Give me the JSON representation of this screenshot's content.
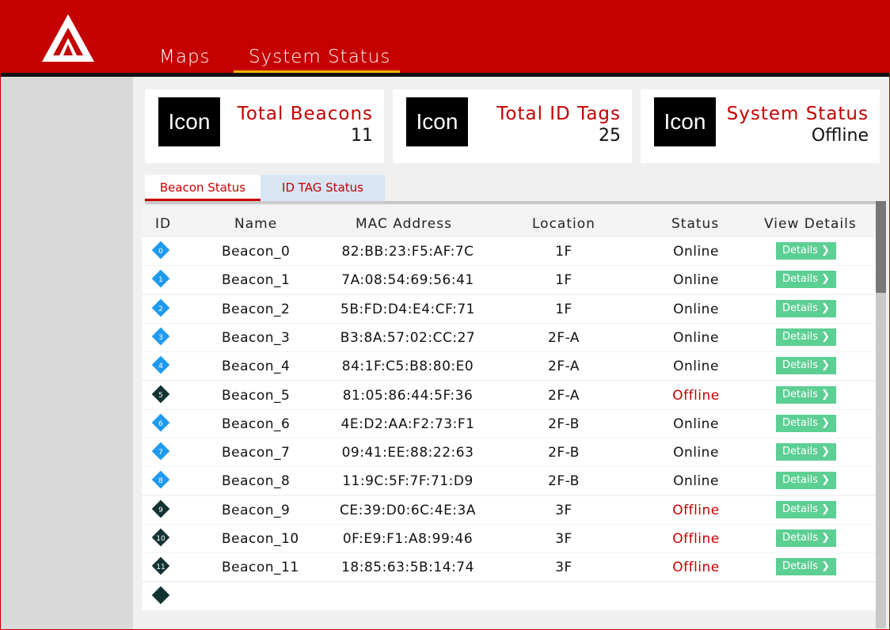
{
  "nav": {
    "maps": "Maps",
    "system_status": "System Status",
    "active": "system_status"
  },
  "summary": {
    "beacons": {
      "icon": "Icon",
      "label": "Total Beacons",
      "value": "11"
    },
    "id_tags": {
      "icon": "Icon",
      "label": "Total ID Tags",
      "value": "25"
    },
    "system": {
      "icon": "Icon",
      "label": "System Status",
      "value": "Offline"
    }
  },
  "tabs": {
    "beacon_status": "Beacon Status",
    "id_tag_status": "ID TAG Status",
    "active": "beacon_status"
  },
  "table": {
    "headers": {
      "id": "ID",
      "name": "Name",
      "mac": "MAC Address",
      "location": "Location",
      "status": "Status",
      "details": "View Details"
    },
    "details_label": "Details ❯",
    "rows": [
      {
        "id": "0",
        "name": "Beacon_0",
        "mac": "82:BB:23:F5:AF:7C",
        "location": "1F",
        "status": "Online"
      },
      {
        "id": "1",
        "name": "Beacon_1",
        "mac": "7A:08:54:69:56:41",
        "location": "1F",
        "status": "Online"
      },
      {
        "id": "2",
        "name": "Beacon_2",
        "mac": "5B:FD:D4:E4:CF:71",
        "location": "1F",
        "status": "Online"
      },
      {
        "id": "3",
        "name": "Beacon_3",
        "mac": "B3:8A:57:02:CC:27",
        "location": "2F-A",
        "status": "Online"
      },
      {
        "id": "4",
        "name": "Beacon_4",
        "mac": "84:1F:C5:B8:80:E0",
        "location": "2F-A",
        "status": "Online"
      },
      {
        "id": "5",
        "name": "Beacon_5",
        "mac": "81:05:86:44:5F:36",
        "location": "2F-A",
        "status": "Offline"
      },
      {
        "id": "6",
        "name": "Beacon_6",
        "mac": "4E:D2:AA:F2:73:F1",
        "location": "2F-B",
        "status": "Online"
      },
      {
        "id": "7",
        "name": "Beacon_7",
        "mac": "09:41:EE:88:22:63",
        "location": "2F-B",
        "status": "Online"
      },
      {
        "id": "8",
        "name": "Beacon_8",
        "mac": "11:9C:5F:7F:71:D9",
        "location": "2F-B",
        "status": "Online"
      },
      {
        "id": "9",
        "name": "Beacon_9",
        "mac": "CE:39:D0:6C:4E:3A",
        "location": "3F",
        "status": "Offline"
      },
      {
        "id": "10",
        "name": "Beacon_10",
        "mac": "0F:E9:F1:A8:99:46",
        "location": "3F",
        "status": "Offline"
      },
      {
        "id": "11",
        "name": "Beacon_11",
        "mac": "18:85:63:5B:14:74",
        "location": "3F",
        "status": "Offline"
      }
    ]
  },
  "colors": {
    "brand_red": "#c40000",
    "accent_yellow": "#f5b400",
    "online_marker": "#1e9af0",
    "offline_marker": "#143333",
    "details_button": "#5ccf93"
  }
}
